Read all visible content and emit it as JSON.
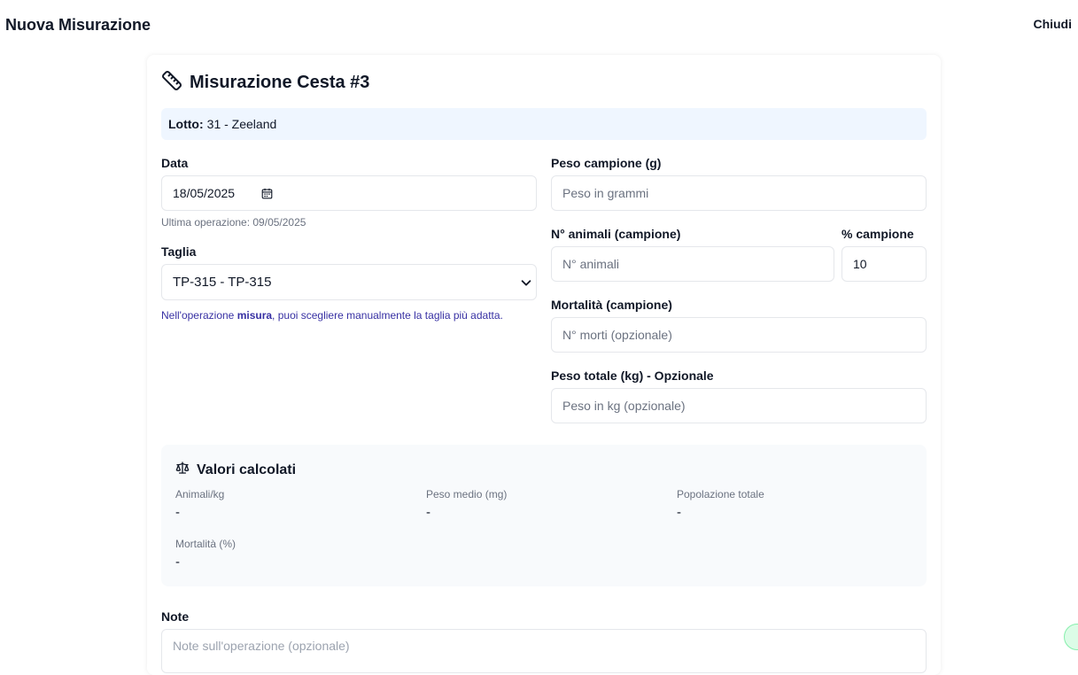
{
  "app": {
    "title": "Nuova Misurazione",
    "close_label": "Chiudi"
  },
  "card": {
    "title": "Misurazione Cesta #3",
    "icon": "ruler-icon"
  },
  "lot": {
    "label": "Lotto:",
    "value": "31 - Zeeland"
  },
  "form": {
    "data": {
      "label": "Data",
      "value": "18/05/2025",
      "hint": "Ultima operazione: 09/05/2025"
    },
    "taglia": {
      "label": "Taglia",
      "value": "TP-315 - TP-315",
      "hint_pre": "Nell'operazione ",
      "hint_bold": "misura",
      "hint_post": ", puoi scegliere manualmente la taglia più adatta."
    },
    "peso_campione": {
      "label": "Peso campione (g)",
      "placeholder": "Peso in grammi"
    },
    "n_animali": {
      "label": "N° animali (campione)",
      "placeholder": "N° animali"
    },
    "perc_campione": {
      "label": "% campione",
      "value": "10"
    },
    "mortalita": {
      "label": "Mortalità (campione)",
      "placeholder": "N° morti (opzionale)"
    },
    "peso_totale": {
      "label": "Peso totale (kg) - Opzionale",
      "placeholder": "Peso in kg (opzionale)"
    }
  },
  "calc": {
    "title": "Valori calcolati",
    "icon": "scale-icon",
    "metrics": [
      {
        "label": "Animali/kg",
        "value": "-"
      },
      {
        "label": "Peso medio (mg)",
        "value": "-"
      },
      {
        "label": "Popolazione totale",
        "value": "-"
      },
      {
        "label": "Mortalità (%)",
        "value": "-"
      }
    ]
  },
  "notes": {
    "label": "Note",
    "placeholder": "Note sull'operazione (opzionale)"
  },
  "colors": {
    "lot_bg": "#eff6ff",
    "calc_bg": "#f8fafc",
    "hint_blue": "#3730a3"
  }
}
